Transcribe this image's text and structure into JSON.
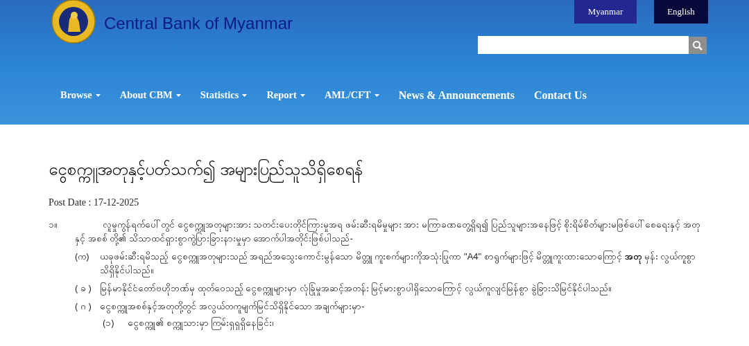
{
  "header": {
    "site_title": "Central Bank of Myanmar",
    "languages": [
      {
        "label": "Myanmar",
        "selected": false
      },
      {
        "label": "English",
        "selected": true
      }
    ],
    "nav": [
      {
        "label": "Browse",
        "has_dropdown": true
      },
      {
        "label": "About CBM",
        "has_dropdown": true
      },
      {
        "label": "Statistics",
        "has_dropdown": true
      },
      {
        "label": "Report",
        "has_dropdown": true
      },
      {
        "label": "AML/CFT",
        "has_dropdown": true
      },
      {
        "label": "News & Announcements",
        "has_dropdown": false
      },
      {
        "label": "Contact Us",
        "has_dropdown": false
      }
    ]
  },
  "article": {
    "title": "ငွေစက္ကူအတုနှင့်ပတ်သက်၍ အများပြည်သူသိရှိစေရန်",
    "post_date": "Post Date : 17-12-2025",
    "items": [
      {
        "marker": "၁။",
        "text": "လူမှုကွန်ရက်ပေါ်တွင် ငွေစက္ကူအတုများအား သတင်းပေးတိုင်ကြားမှုအရ ဖမ်းဆီးရမိမှုများ အား မကြာခဏတွေ့ရှိရ၍ ပြည်သူများအနေဖြင့် စိုးရိမ်စိတ်များမဖြစ်ပေါ်စေရေးနှင့် အတုနှင့် အစစ် တို့၏ သိသာထင်ရှားစွာကွဲပြားခြားနားမှုမှာ အောက်ပါအတိုင်းဖြစ်ပါသည်-",
        "children": [
          {
            "marker": "(က)",
            "text": "ယခုဖမ်းဆီးရမိသည့် ငွေစက္ကူအတုများသည် အရည်အသွေးကောင်းမွန်သော မိတ္တူ ကူးစက်များကိုအသုံးပြုကာ \"A4\" စာရွက်များဖြင့် မိတ္တူကူးထားသောကြောင့် **အတု** မှန်း လွယ်ကူစွာသိရှိနိုင်ပါသည်။"
          },
          {
            "marker": "( ခ )",
            "text": "မြန်မာနိုင်ငံတော်ဗဟိုဘဏ်မှ ထုတ်ဝေသည့် ငွေစက္ကူများမှာ လုံခြုံမှုအဆင့်အတန်း မြင့်မားစွာပါရှိသောကြောင့် လွယ်ကူလျင်မြန်စွာ ခွဲခြားသိမြင်နိုင်ပါသည်။"
          },
          {
            "marker": "( ဂ )",
            "text": "ငွေစက္ကူအစစ်နှင့်အတုတို့တွင် အလွယ်တကူမျက်မြင်သိရှိနိုင်သော အချက်များမှာ-",
            "children": [
              {
                "marker": "(၁)",
                "text": "ငွေစက္ကူ၏ စက္ကူသားမှာ ကြမ်းရှရှရှိနေခြင်း၊"
              }
            ]
          }
        ]
      }
    ]
  }
}
